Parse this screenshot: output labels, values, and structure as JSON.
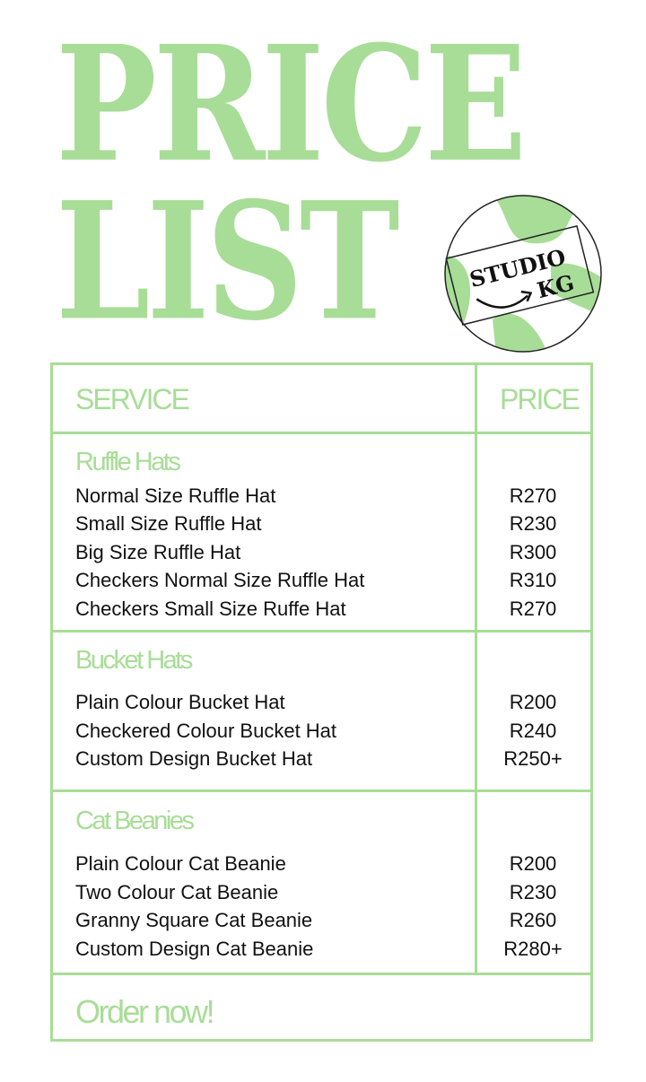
{
  "title": {
    "line1": "PRICE",
    "line2": "LIST"
  },
  "logo": {
    "line1": "STUDIO",
    "line2": "KG"
  },
  "table": {
    "header_service": "SERVICE",
    "header_price": "PRICE",
    "sections": [
      {
        "name": "Ruffle Hats",
        "items": [
          {
            "service": "Normal Size Ruffle Hat",
            "price": "R270"
          },
          {
            "service": "Small Size Ruffle Hat",
            "price": "R230"
          },
          {
            "service": "Big Size Ruffle Hat",
            "price": "R300"
          },
          {
            "service": "Checkers Normal Size Ruffle Hat",
            "price": "R310"
          },
          {
            "service": "Checkers Small Size Ruffe Hat",
            "price": "R270"
          }
        ]
      },
      {
        "name": "Bucket Hats",
        "items": [
          {
            "service": "Plain Colour Bucket Hat",
            "price": "R200"
          },
          {
            "service": "Checkered Colour Bucket Hat",
            "price": "R240"
          },
          {
            "service": "Custom Design Bucket Hat",
            "price": "R250+"
          }
        ]
      },
      {
        "name": "Cat Beanies",
        "items": [
          {
            "service": "Plain Colour Cat Beanie",
            "price": "R200"
          },
          {
            "service": "Two Colour Cat Beanie",
            "price": "R230"
          },
          {
            "service": "Granny Square Cat Beanie",
            "price": "R260"
          },
          {
            "service": "Custom Design Cat Beanie",
            "price": "R280+"
          }
        ]
      }
    ],
    "footer": "Order now!"
  },
  "colors": {
    "accent": "#a8dd97",
    "text": "#111111",
    "background": "#ffffff"
  }
}
